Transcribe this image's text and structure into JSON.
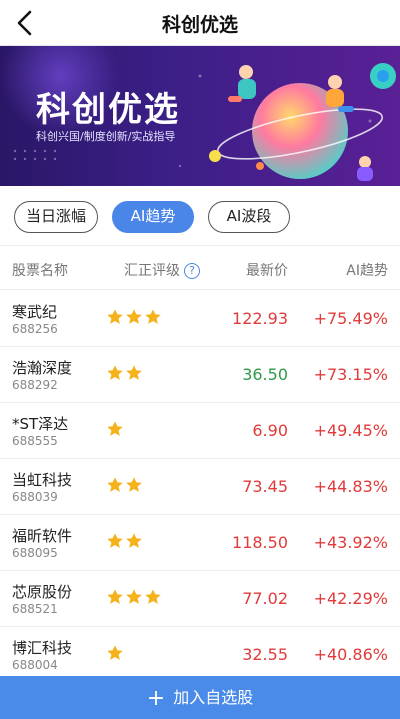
{
  "nav": {
    "title": "科创优选"
  },
  "banner": {
    "title": "科创优选",
    "subtitle": "科创兴国/制度创新/实战指导"
  },
  "tabs": [
    {
      "label": "当日涨幅",
      "active": false
    },
    {
      "label": "AI趋势",
      "active": true
    },
    {
      "label": "AI波段",
      "active": false
    }
  ],
  "table": {
    "headers": {
      "name": "股票名称",
      "rating": "汇正评级",
      "price": "最新价",
      "trend": "AI趋势"
    },
    "help_icon": "?",
    "rows": [
      {
        "name": "寒武纪",
        "code": "688256",
        "stars": 3,
        "price": "122.93",
        "price_dir": "up",
        "trend": "+75.49%"
      },
      {
        "name": "浩瀚深度",
        "code": "688292",
        "stars": 2,
        "price": "36.50",
        "price_dir": "down",
        "trend": "+73.15%"
      },
      {
        "name": "*ST泽达",
        "code": "688555",
        "stars": 1,
        "price": "6.90",
        "price_dir": "up",
        "trend": "+49.45%"
      },
      {
        "name": "当虹科技",
        "code": "688039",
        "stars": 2,
        "price": "73.45",
        "price_dir": "up",
        "trend": "+44.83%"
      },
      {
        "name": "福昕软件",
        "code": "688095",
        "stars": 2,
        "price": "118.50",
        "price_dir": "up",
        "trend": "+43.92%"
      },
      {
        "name": "芯原股份",
        "code": "688521",
        "stars": 3,
        "price": "77.02",
        "price_dir": "up",
        "trend": "+42.29%"
      },
      {
        "name": "博汇科技",
        "code": "688004",
        "stars": 1,
        "price": "32.55",
        "price_dir": "up",
        "trend": "+40.86%"
      }
    ]
  },
  "add_button": {
    "label": "加入自选股",
    "icon": "plus-icon"
  },
  "colors": {
    "accent": "#4a86e8",
    "up": "#e03a3a",
    "down": "#2e9a48",
    "star": "#f5b21b"
  }
}
